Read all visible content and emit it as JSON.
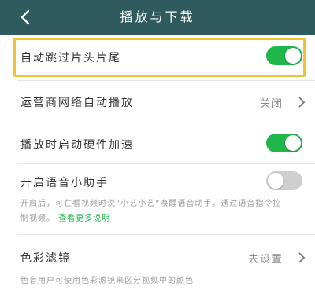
{
  "header": {
    "title": "播放与下载"
  },
  "settings": {
    "skip_intro": {
      "label": "自动跳过片头片尾",
      "enabled": true
    },
    "carrier_autoplay": {
      "label": "运营商网络自动播放",
      "value": "关闭"
    },
    "hw_accel": {
      "label": "播放时启动硬件加速",
      "enabled": true
    },
    "voice_assistant": {
      "label": "开启语音小助手",
      "enabled": false,
      "description": "开启后，可在看视频时说“小艺小艺”唤醒语音助手，通过语音指令控制视频。",
      "more_link": "查看更多说明"
    },
    "color_filter": {
      "label": "色彩滤镜",
      "value": "去设置",
      "description": "色盲用户可使用色彩滤镜来区分视频中的颜色"
    }
  },
  "colors": {
    "header": "#2f5a60",
    "toggle_on": "#1fb64a",
    "toggle_off": "#cfcfcf",
    "highlight": "#f1c232"
  }
}
